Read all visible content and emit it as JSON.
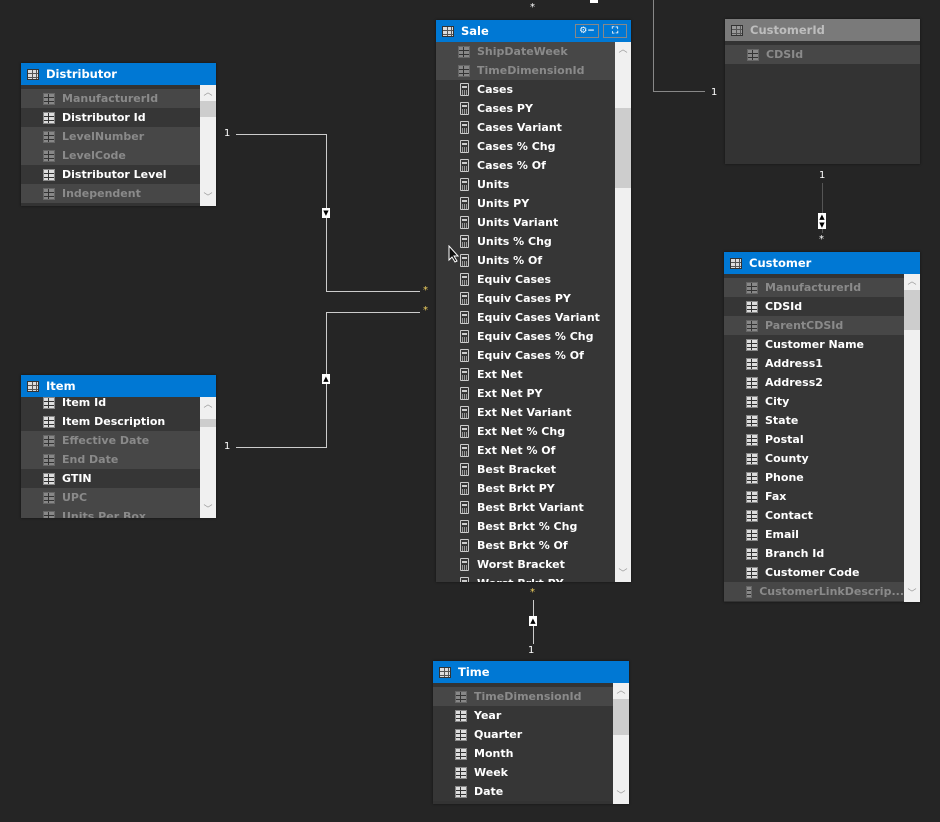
{
  "tables": {
    "distributor": {
      "title": "Distributor",
      "rows": [
        {
          "label": "ManufacturerId",
          "hidden": true,
          "type": "column"
        },
        {
          "label": "Distributor Id",
          "hidden": false,
          "type": "column"
        },
        {
          "label": "LevelNumber",
          "hidden": true,
          "type": "column"
        },
        {
          "label": "LevelCode",
          "hidden": true,
          "type": "column"
        },
        {
          "label": "Distributor Level",
          "hidden": false,
          "type": "column"
        },
        {
          "label": "Independent",
          "hidden": true,
          "type": "column"
        }
      ]
    },
    "item": {
      "title": "Item",
      "rows": [
        {
          "label": "Item Id",
          "hidden": false,
          "type": "column"
        },
        {
          "label": "Item Description",
          "hidden": false,
          "type": "column"
        },
        {
          "label": "Effective Date",
          "hidden": true,
          "type": "column"
        },
        {
          "label": "End Date",
          "hidden": true,
          "type": "column"
        },
        {
          "label": "GTIN",
          "hidden": false,
          "type": "column"
        },
        {
          "label": "UPC",
          "hidden": true,
          "type": "column"
        },
        {
          "label": "Units Per Box",
          "hidden": true,
          "type": "column"
        }
      ]
    },
    "sale": {
      "title": "Sale",
      "rows": [
        {
          "label": "ShipDateWeek",
          "hidden": true,
          "type": "column"
        },
        {
          "label": "TimeDimensionId",
          "hidden": true,
          "type": "column"
        },
        {
          "label": "Cases",
          "hidden": false,
          "type": "measure"
        },
        {
          "label": "Cases PY",
          "hidden": false,
          "type": "measure"
        },
        {
          "label": "Cases Variant",
          "hidden": false,
          "type": "measure"
        },
        {
          "label": "Cases % Chg",
          "hidden": false,
          "type": "measure"
        },
        {
          "label": "Cases % Of",
          "hidden": false,
          "type": "measure"
        },
        {
          "label": "Units",
          "hidden": false,
          "type": "measure"
        },
        {
          "label": "Units PY",
          "hidden": false,
          "type": "measure"
        },
        {
          "label": "Units Variant",
          "hidden": false,
          "type": "measure"
        },
        {
          "label": "Units % Chg",
          "hidden": false,
          "type": "measure"
        },
        {
          "label": "Units % Of",
          "hidden": false,
          "type": "measure"
        },
        {
          "label": "Equiv Cases",
          "hidden": false,
          "type": "measure"
        },
        {
          "label": "Equiv Cases PY",
          "hidden": false,
          "type": "measure"
        },
        {
          "label": "Equiv Cases Variant",
          "hidden": false,
          "type": "measure"
        },
        {
          "label": "Equiv Cases % Chg",
          "hidden": false,
          "type": "measure"
        },
        {
          "label": "Equiv Cases % Of",
          "hidden": false,
          "type": "measure"
        },
        {
          "label": "Ext Net",
          "hidden": false,
          "type": "measure"
        },
        {
          "label": "Ext Net PY",
          "hidden": false,
          "type": "measure"
        },
        {
          "label": "Ext Net Variant",
          "hidden": false,
          "type": "measure"
        },
        {
          "label": "Ext Net % Chg",
          "hidden": false,
          "type": "measure"
        },
        {
          "label": "Ext Net % Of",
          "hidden": false,
          "type": "measure"
        },
        {
          "label": "Best Bracket",
          "hidden": false,
          "type": "measure"
        },
        {
          "label": "Best Brkt PY",
          "hidden": false,
          "type": "measure"
        },
        {
          "label": "Best Brkt Variant",
          "hidden": false,
          "type": "measure"
        },
        {
          "label": "Best Brkt % Chg",
          "hidden": false,
          "type": "measure"
        },
        {
          "label": "Best Brkt % Of",
          "hidden": false,
          "type": "measure"
        },
        {
          "label": "Worst Bracket",
          "hidden": false,
          "type": "measure"
        },
        {
          "label": "Worst Brkt PY",
          "hidden": false,
          "type": "measure"
        }
      ]
    },
    "customerid": {
      "title": "CustomerId",
      "rows": [
        {
          "label": "CDSId",
          "hidden": true,
          "type": "column"
        }
      ]
    },
    "customer": {
      "title": "Customer",
      "rows": [
        {
          "label": "ManufacturerId",
          "hidden": true,
          "type": "column"
        },
        {
          "label": "CDSId",
          "hidden": false,
          "type": "column"
        },
        {
          "label": "ParentCDSId",
          "hidden": true,
          "type": "column"
        },
        {
          "label": "Customer Name",
          "hidden": false,
          "type": "column"
        },
        {
          "label": "Address1",
          "hidden": false,
          "type": "column"
        },
        {
          "label": "Address2",
          "hidden": false,
          "type": "column"
        },
        {
          "label": "City",
          "hidden": false,
          "type": "column"
        },
        {
          "label": "State",
          "hidden": false,
          "type": "column"
        },
        {
          "label": "Postal",
          "hidden": false,
          "type": "column"
        },
        {
          "label": "County",
          "hidden": false,
          "type": "column"
        },
        {
          "label": "Phone",
          "hidden": false,
          "type": "column"
        },
        {
          "label": "Fax",
          "hidden": false,
          "type": "column"
        },
        {
          "label": "Contact",
          "hidden": false,
          "type": "column"
        },
        {
          "label": "Email",
          "hidden": false,
          "type": "column"
        },
        {
          "label": "Branch Id",
          "hidden": false,
          "type": "column"
        },
        {
          "label": "Customer Code",
          "hidden": false,
          "type": "column"
        },
        {
          "label": "CustomerLinkDescrip...",
          "hidden": true,
          "type": "column"
        }
      ]
    },
    "time": {
      "title": "Time",
      "rows": [
        {
          "label": "TimeDimensionId",
          "hidden": true,
          "type": "column"
        },
        {
          "label": "Year",
          "hidden": false,
          "type": "column"
        },
        {
          "label": "Quarter",
          "hidden": false,
          "type": "column"
        },
        {
          "label": "Month",
          "hidden": false,
          "type": "column"
        },
        {
          "label": "Week",
          "hidden": false,
          "type": "column"
        },
        {
          "label": "Date",
          "hidden": false,
          "type": "column"
        }
      ]
    }
  },
  "relationships": {
    "one": "1",
    "many": "*"
  },
  "colors": {
    "header_active": "#0078d4",
    "header_inactive": "#7a7a7a",
    "canvas": "#252525"
  }
}
